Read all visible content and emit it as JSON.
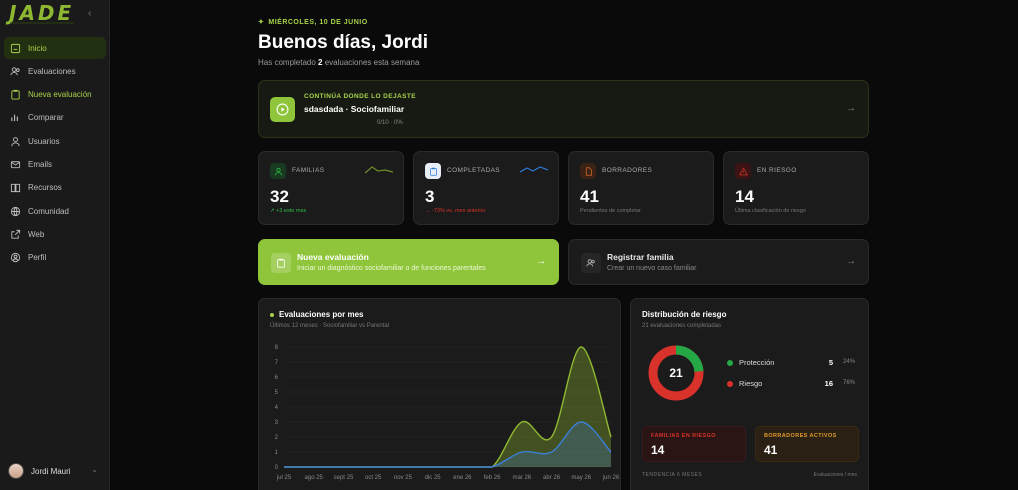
{
  "app": {
    "logo": "JADE"
  },
  "sidebar": {
    "items": [
      {
        "label": "Inicio",
        "icon": "home-icon"
      },
      {
        "label": "Evaluaciones",
        "icon": "users-icon"
      },
      {
        "label": "Nueva evaluación",
        "icon": "clipboard-icon"
      },
      {
        "label": "Comparar",
        "icon": "chart-icon"
      },
      {
        "label": "Usuarios",
        "icon": "user-icon"
      },
      {
        "label": "Emails",
        "icon": "mail-icon"
      },
      {
        "label": "Recursos",
        "icon": "book-icon"
      },
      {
        "label": "Comunidad",
        "icon": "globe-icon"
      },
      {
        "label": "Web",
        "icon": "external-link-icon"
      },
      {
        "label": "Perfil",
        "icon": "profile-icon"
      }
    ],
    "user": {
      "name": "Jordi Mauri"
    }
  },
  "header": {
    "date": "MIÉRCOLES, 10 DE JUNIO",
    "greeting": "Buenos días, Jordi",
    "subtitle_pre": "Has completado ",
    "subtitle_count": "2",
    "subtitle_post": " evaluaciones esta semana"
  },
  "continue": {
    "tag": "CONTINÚA DONDE LO DEJASTE",
    "title": "sdasdada · Sociofamiliar",
    "progress": "0/10 · 0%"
  },
  "stats": [
    {
      "label": "FAMILIAS",
      "value": "32",
      "foot": "↗ +3 este mes",
      "trend": "up",
      "color": "#2fbf4a"
    },
    {
      "label": "COMPLETADAS",
      "value": "3",
      "foot": "→ -73% vs. mes anterior",
      "trend": "down",
      "color": "#2f7fd9"
    },
    {
      "label": "BORRADORES",
      "value": "41",
      "foot": "Pendientes de completar",
      "trend": "none",
      "color": "#d96a2b"
    },
    {
      "label": "EN RIESGO",
      "value": "14",
      "foot": "Última clasificación de riesgo",
      "trend": "none",
      "color": "#d9322b"
    }
  ],
  "actions": {
    "new_eval": {
      "title": "Nueva evaluación",
      "desc": "Iniciar un diagnóstico sociofamiliar o de funciones parentales"
    },
    "register": {
      "title": "Registrar familia",
      "desc": "Crear un nuevo caso familiar"
    }
  },
  "chart_card": {
    "title": "Evaluaciones por mes",
    "subtitle": "Últimos 12 meses · Sociofamiliar vs Parental"
  },
  "chart_data": {
    "type": "area",
    "categories": [
      "jul 25",
      "ago 25",
      "sept 25",
      "oct 25",
      "nov 25",
      "dic 25",
      "ene 26",
      "feb 26",
      "mar 26",
      "abr 26",
      "may 26",
      "jun 26"
    ],
    "ylim": [
      0,
      8
    ],
    "yticks": [
      "0",
      "1",
      "2",
      "3",
      "4",
      "5",
      "6",
      "7",
      "8"
    ],
    "series": [
      {
        "values": [
          0,
          0,
          0,
          0,
          0,
          0,
          0,
          0,
          3,
          2,
          8,
          2
        ],
        "color": "#8fb832"
      },
      {
        "values": [
          0,
          0,
          0,
          0,
          0,
          0,
          0,
          0,
          1,
          1,
          3,
          1
        ],
        "color": "#3a7fd9"
      }
    ]
  },
  "risk": {
    "title": "Distribución de riesgo",
    "subtitle": "21 evaluaciones completadas",
    "total": "21",
    "legend": [
      {
        "label": "Protección",
        "count": "5",
        "pct": "24%",
        "color": "#23a845"
      },
      {
        "label": "Riesgo",
        "count": "16",
        "pct": "76%",
        "color": "#d9322b"
      }
    ],
    "mini": [
      {
        "label": "FAMILIAS EN RIESGO",
        "value": "14"
      },
      {
        "label": "BORRADORES ACTIVOS",
        "value": "41"
      }
    ],
    "footer_left": "TENDENCIA 6 MESES",
    "footer_right": "Evaluaciones / mes"
  }
}
